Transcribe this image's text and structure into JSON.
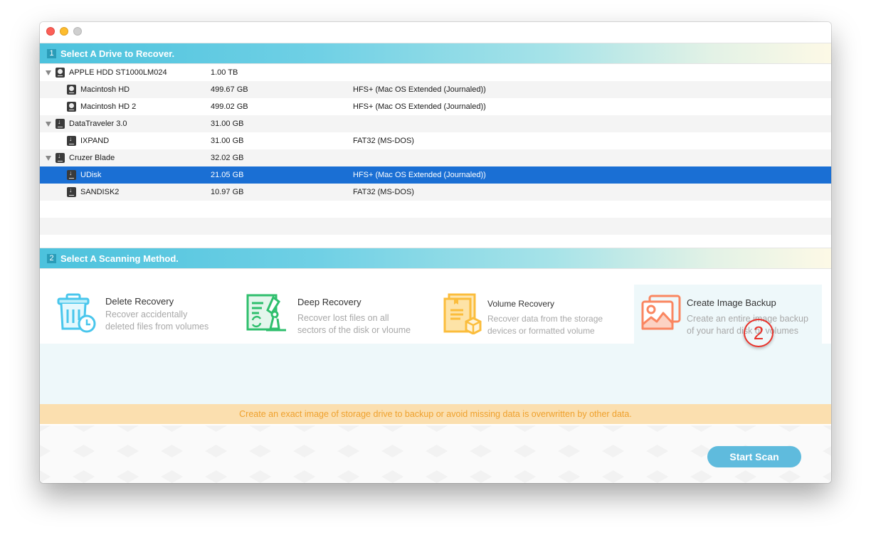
{
  "window": {
    "controls": [
      "close",
      "minimize",
      "maximize"
    ]
  },
  "step1": {
    "number": "1",
    "title": "Select A Drive to Recover."
  },
  "drives": [
    {
      "level": "parent",
      "icon": "hdd-icon",
      "name": "APPLE HDD ST1000LM024",
      "size": "1.00 TB",
      "fs": ""
    },
    {
      "level": "child",
      "icon": "hdd-icon",
      "name": "Macintosh HD",
      "size": "499.67 GB",
      "fs": "HFS+ (Mac OS Extended (Journaled))"
    },
    {
      "level": "child",
      "icon": "hdd-icon",
      "name": "Macintosh HD 2",
      "size": "499.02 GB",
      "fs": "HFS+ (Mac OS Extended (Journaled))"
    },
    {
      "level": "parent",
      "icon": "usb-drive-icon",
      "name": "DataTraveler 3.0",
      "size": "31.00 GB",
      "fs": ""
    },
    {
      "level": "child",
      "icon": "usb-drive-icon",
      "name": "IXPAND",
      "size": "31.00 GB",
      "fs": "FAT32 (MS-DOS)"
    },
    {
      "level": "parent",
      "icon": "usb-drive-icon",
      "name": "Cruzer Blade",
      "size": "32.02 GB",
      "fs": ""
    },
    {
      "level": "child",
      "icon": "usb-drive-icon",
      "name": "UDisk",
      "size": "21.05 GB",
      "fs": "HFS+ (Mac OS Extended (Journaled))",
      "selected": true
    },
    {
      "level": "child",
      "icon": "usb-drive-icon",
      "name": "SANDISK2",
      "size": "10.97 GB",
      "fs": "FAT32 (MS-DOS)"
    }
  ],
  "step2": {
    "number": "2",
    "title": "Select A Scanning Method."
  },
  "methods": [
    {
      "title": "Delete Recovery",
      "desc1": "Recover accidentally",
      "desc2": "deleted files from volumes",
      "icon": "trash-clock-icon"
    },
    {
      "title": "Deep Recovery",
      "desc1": "Recover lost files on all",
      "desc2": "sectors of the disk or vloume",
      "icon": "microscope-document-icon"
    },
    {
      "title": "Volume Recovery",
      "desc1": "Recover data from the storage",
      "desc2": "devices or formatted volume",
      "icon": "document-box-icon"
    },
    {
      "title": "Create Image Backup",
      "desc1": "Create an entire image backup",
      "desc2": "of your hard disk or volumes",
      "icon": "image-stack-icon",
      "selected": true
    }
  ],
  "annotation": {
    "label": "2"
  },
  "tip": "Create an exact image of storage drive to backup or avoid missing data is overwritten by other data.",
  "actions": {
    "start_scan": "Start Scan"
  },
  "colors": {
    "header_accent": "#4cc2dd",
    "selection": "#1a6fd4",
    "tip_bg": "#fbdfaf",
    "tip_text": "#efa12d",
    "button": "#5fbbdd",
    "annotation": "#e8322a"
  }
}
